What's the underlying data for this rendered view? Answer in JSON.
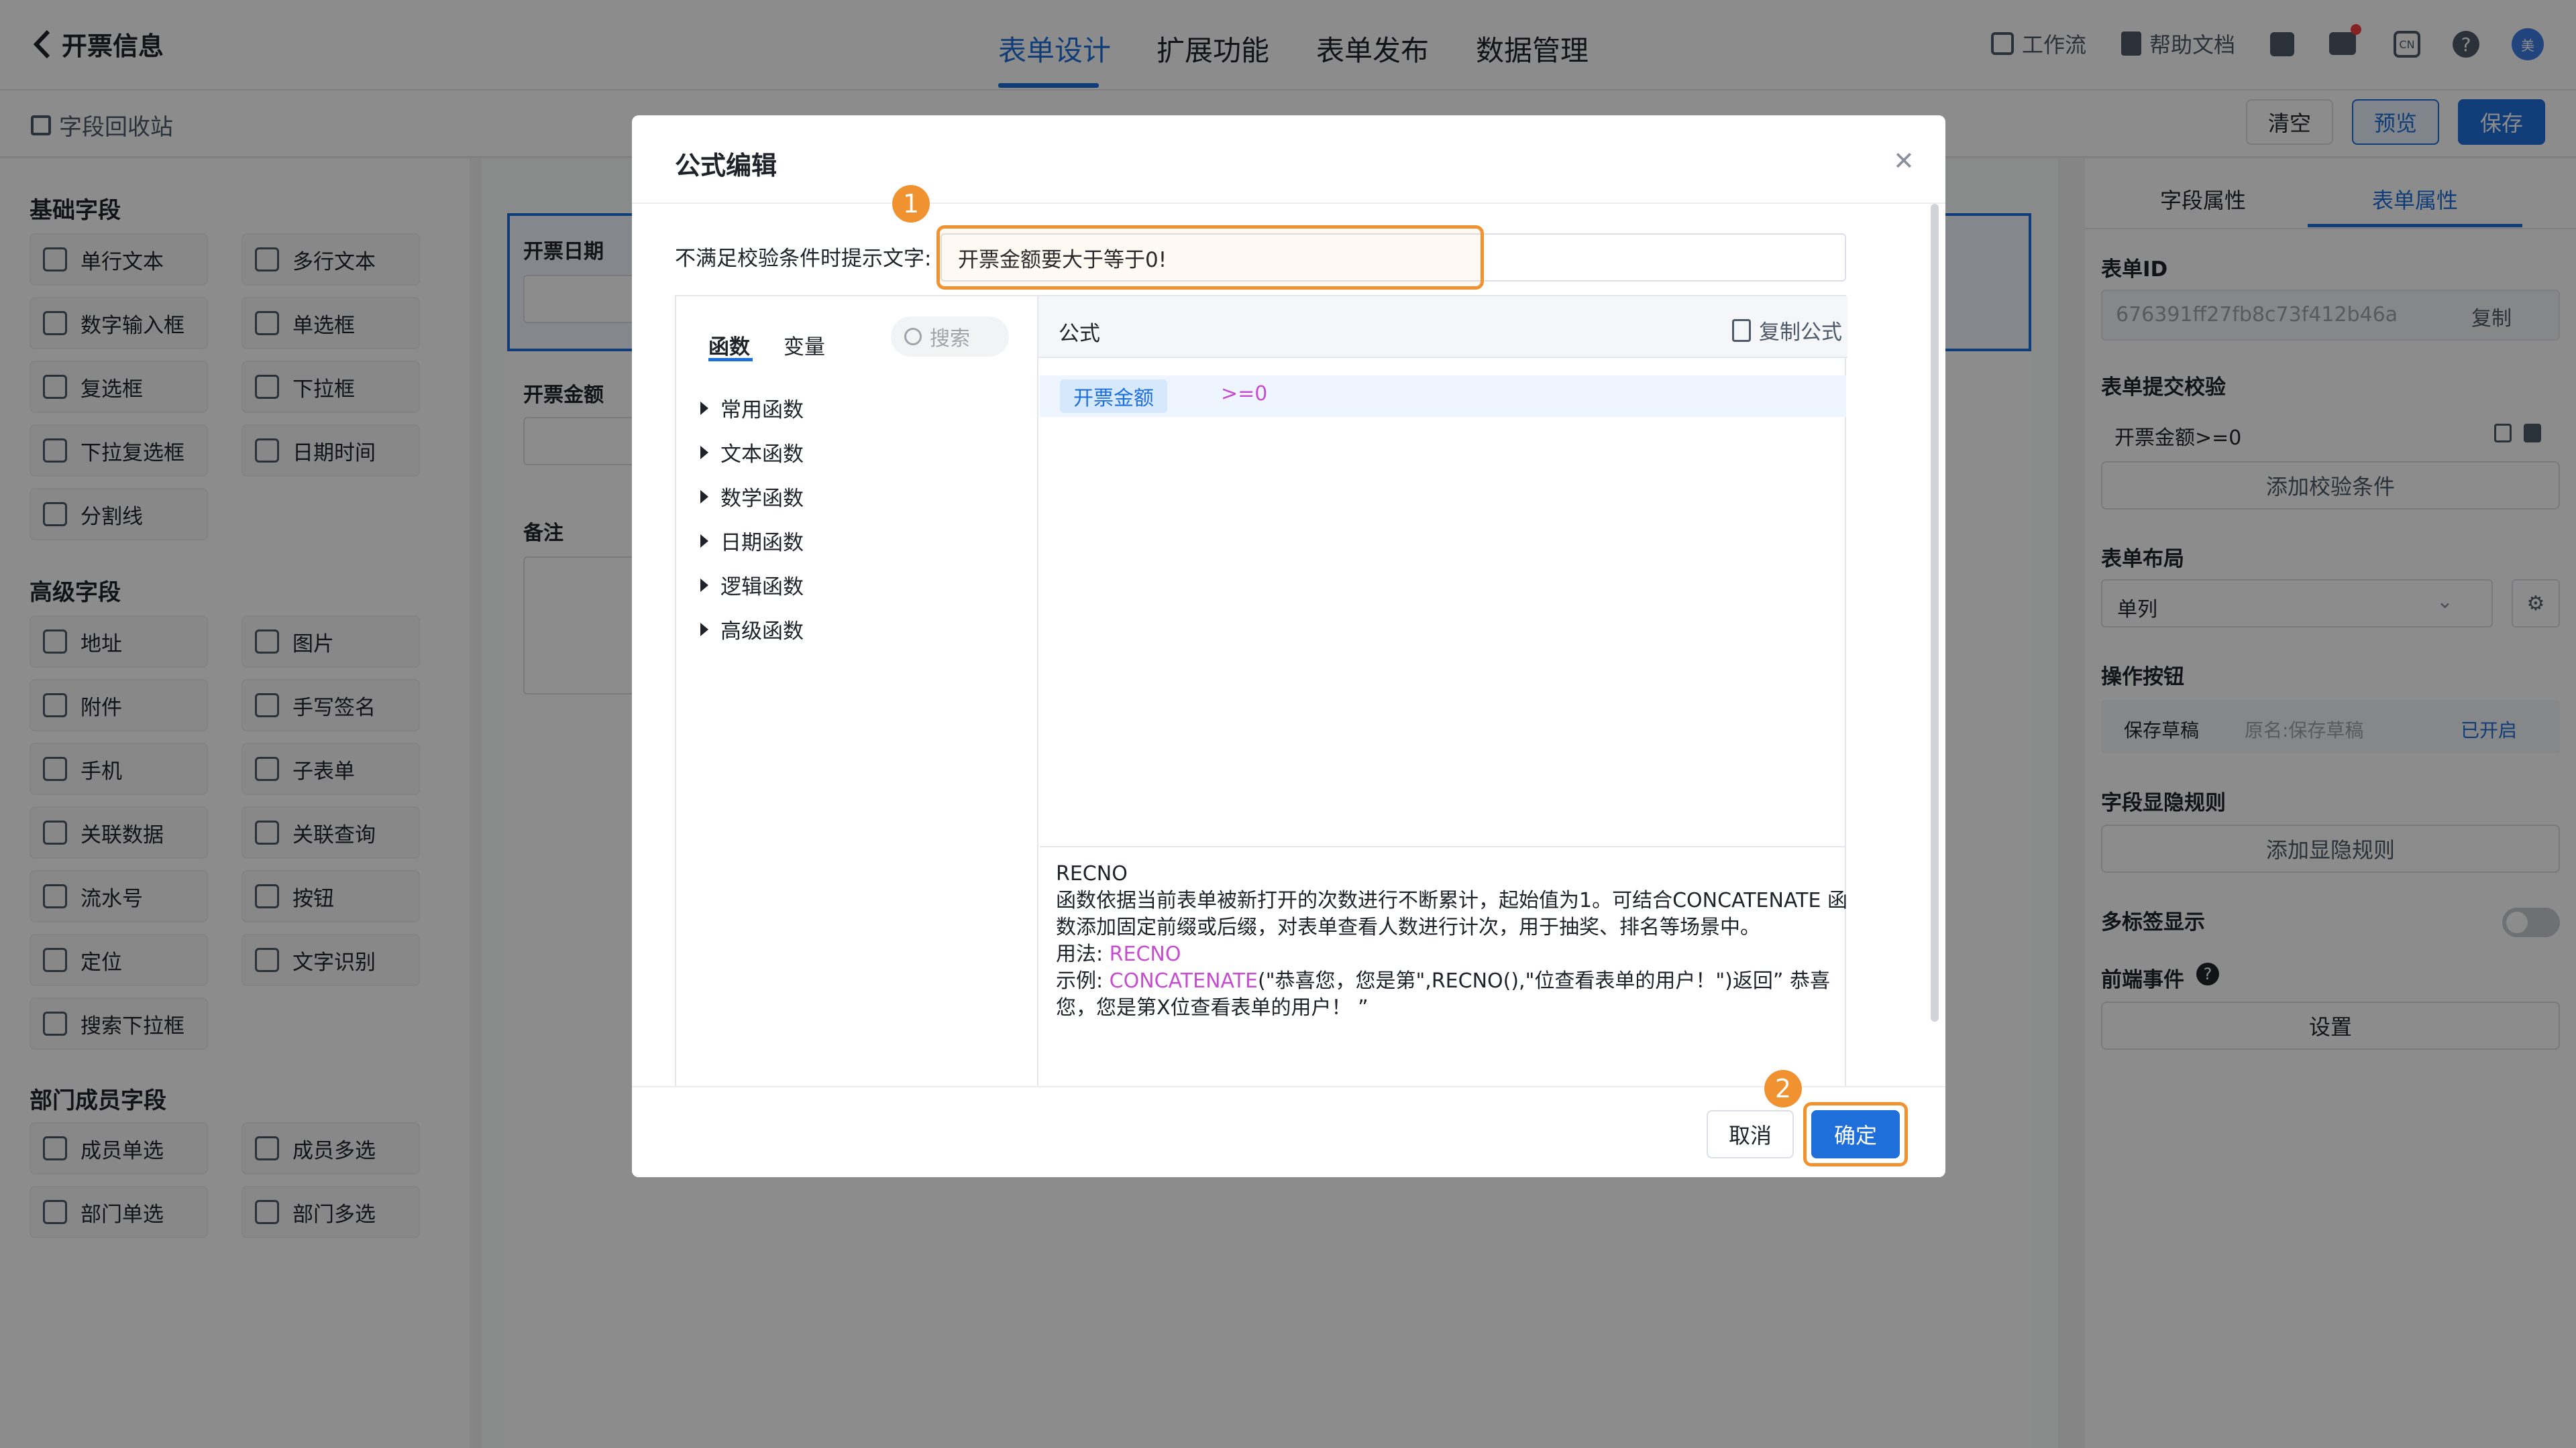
{
  "header": {
    "back_title": "开票信息",
    "tabs": [
      {
        "label": "表单设计"
      },
      {
        "label": "扩展功能"
      },
      {
        "label": "表单发布"
      },
      {
        "label": "数据管理"
      }
    ],
    "tools": {
      "workflow": "工作流",
      "help_doc": "帮助文档",
      "lang": "CN",
      "avatar": "美"
    }
  },
  "toolbar": {
    "recycle": "字段回收站",
    "clear": "清空",
    "preview": "预览",
    "save": "保存"
  },
  "left_panel": {
    "basic_title": "基础字段",
    "basic_fields": [
      "单行文本",
      "多行文本",
      "数字输入框",
      "单选框",
      "复选框",
      "下拉框",
      "下拉复选框",
      "日期时间",
      "分割线"
    ],
    "advanced_title": "高级字段",
    "advanced_fields": [
      "地址",
      "图片",
      "附件",
      "手写签名",
      "手机",
      "子表单",
      "关联数据",
      "关联查询",
      "流水号",
      "按钮",
      "定位",
      "文字识别",
      "搜索下拉框"
    ],
    "dept_title": "部门成员字段",
    "dept_fields": [
      "成员单选",
      "成员多选",
      "部门单选",
      "部门多选"
    ]
  },
  "form_canvas": {
    "field1": "开票日期",
    "field2": "开票金额",
    "field3": "备注"
  },
  "right_panel": {
    "tab_field": "字段属性",
    "tab_form": "表单属性",
    "form_id_label": "表单ID",
    "form_id_value": "676391ff27fb8c73f412b46a",
    "copy": "复制",
    "validate_label": "表单提交校验",
    "validate_rule": "开票金额>=0",
    "add_validate": "添加校验条件",
    "layout_label": "表单布局",
    "layout_value": "单列",
    "action_label": "操作按钮",
    "action_name": "保存草稿",
    "action_orig": "原名:保存草稿",
    "action_status": "已开启",
    "visibility_label": "字段显隐规则",
    "add_visibility": "添加显隐规则",
    "multitab_label": "多标签显示",
    "frontend_label": "前端事件",
    "set": "设置"
  },
  "modal": {
    "title": "公式编辑",
    "hint_label": "不满足校验条件时提示文字:",
    "hint_value": "开票金额要大于等于0!",
    "tab_func": "函数",
    "tab_var": "变量",
    "search_placeholder": "搜索",
    "categories": [
      "常用函数",
      "文本函数",
      "数学函数",
      "日期函数",
      "逻辑函数",
      "高级函数"
    ],
    "formula_header": "公式",
    "copy_formula": "复制公式",
    "formula_field": "开票金额",
    "formula_op": ">=0",
    "desc_name": "RECNO",
    "desc_line1": "函数依据当前表单被新打开的次数进行不断累计，起始值为1。可结合CONCATENATE 函",
    "desc_line2": "数添加固定前缀或后缀，对表单查看人数进行计次，用于抽奖、排名等场景中。",
    "usage_label": "用法: ",
    "usage_value": "RECNO",
    "example_label": "示例: ",
    "example_fn": "CONCATENATE",
    "example_rest": "(\"恭喜您，您是第\",RECNO(),\"位查看表单的用户！\")返回” 恭喜",
    "example_line2": "您，您是第X位查看表单的用户！ ”",
    "cancel": "取消",
    "confirm": "确定",
    "badge1": "1",
    "badge2": "2"
  }
}
